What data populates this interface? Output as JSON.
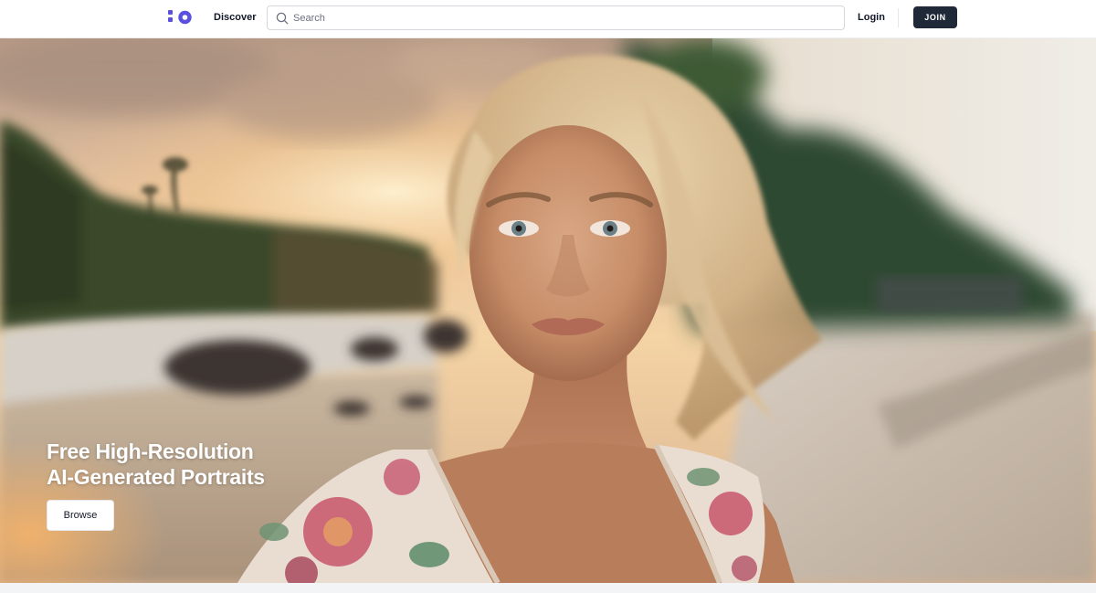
{
  "header": {
    "logo_icon": "brand-logo-icon",
    "discover_label": "Discover",
    "search": {
      "placeholder": "Search",
      "value": "",
      "icon": "search-icon"
    },
    "login_label": "Login",
    "join_label": "JOIN"
  },
  "hero": {
    "title_line1": "Free High-Resolution",
    "title_line2": "AI-Generated Portraits",
    "browse_label": "Browse"
  },
  "colors": {
    "brand": "#5b4fe0",
    "join_bg": "#1f2937",
    "text": "#111827"
  }
}
